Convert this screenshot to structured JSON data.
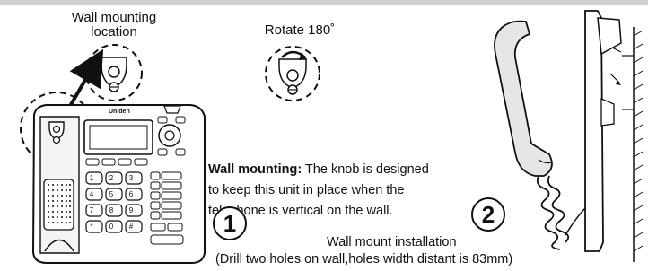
{
  "labels": {
    "wall_mount_location": "Wall mounting location",
    "rotate": "Rotate 180˚"
  },
  "brand": "Uniden",
  "description": {
    "heading": "Wall mounting:",
    "line1": " The knob is designed",
    "line2": "to keep  this unit in place when the",
    "line3": "telephone is vertical  on the wall."
  },
  "steps": {
    "one": "1",
    "two": "2"
  },
  "install": {
    "title": "Wall mount installation",
    "note": "(Drill two holes on wall,holes width distant is 83mm)"
  },
  "keypad": [
    "1",
    "2",
    "3",
    "4",
    "5",
    "6",
    "7",
    "8",
    "9",
    "*",
    "0",
    "#"
  ],
  "icons": {
    "knob": "wall-hook-knob-icon",
    "rotate": "rotate-arrow-icon"
  }
}
